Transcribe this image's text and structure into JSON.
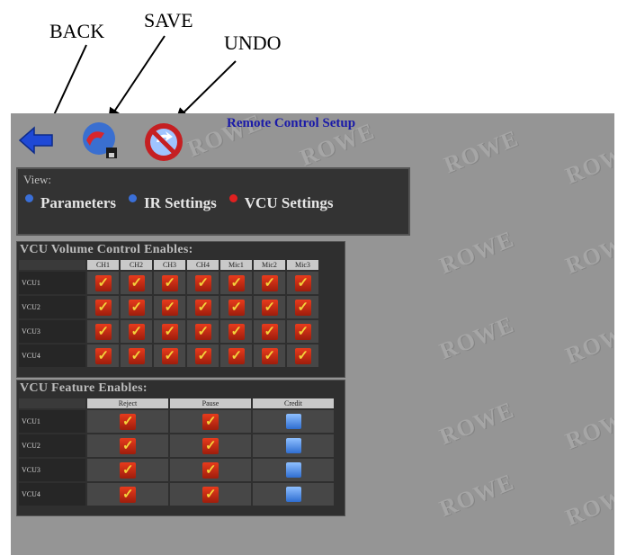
{
  "annotations": {
    "back": "BACK",
    "save": "SAVE",
    "undo": "UNDO"
  },
  "screen": {
    "title": "Remote Control Setup",
    "watermark": "ROWE",
    "toolbar": {
      "back_icon": "left-arrow-icon",
      "save_icon": "save-disk-icon",
      "undo_icon": "undo-icon"
    },
    "view": {
      "label": "View:",
      "options": [
        {
          "label": "Parameters",
          "selected": false
        },
        {
          "label": "IR Settings",
          "selected": false
        },
        {
          "label": "VCU Settings",
          "selected": true
        }
      ]
    },
    "volume_enables": {
      "title": "VCU Volume Control Enables:",
      "columns": [
        "CH1",
        "CH2",
        "CH3",
        "CH4",
        "Mic1",
        "Mic2",
        "Mic3"
      ],
      "rows": [
        "VCU1",
        "VCU2",
        "VCU3",
        "VCU4"
      ]
    },
    "feature_enables": {
      "title": "VCU Feature Enables:",
      "columns": [
        "Reject",
        "Pause",
        "Credit"
      ],
      "rows": [
        "VCU1",
        "VCU2",
        "VCU3",
        "VCU4"
      ]
    }
  },
  "colors": {
    "screen_bg": "#959595",
    "panel_bg": "#2f2f2f",
    "title_blue": "#1a1aa8",
    "check_red": "#d2301a",
    "credit_blue": "#3b7fe0",
    "radio_blue": "#3a6fd8",
    "radio_red": "#e02020"
  }
}
